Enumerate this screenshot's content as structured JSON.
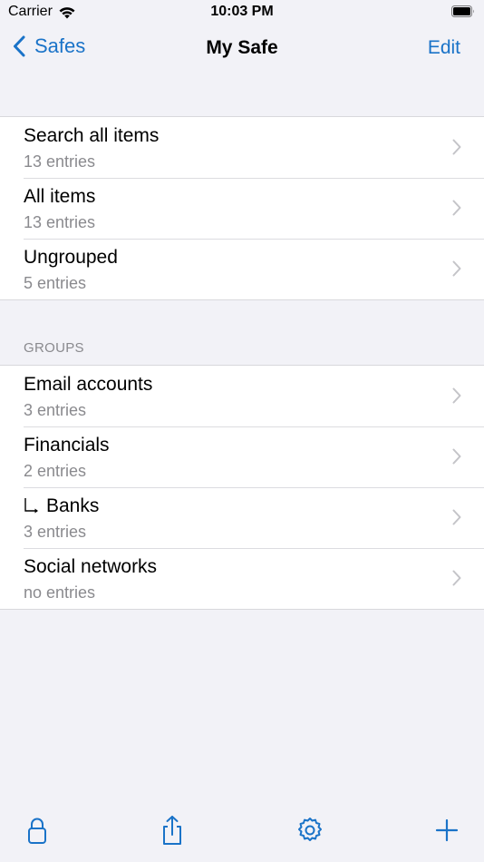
{
  "status_bar": {
    "carrier": "Carrier",
    "time": "10:03 PM"
  },
  "nav": {
    "back_label": "Safes",
    "title": "My Safe",
    "edit_label": "Edit"
  },
  "top_items": [
    {
      "title": "Search all items",
      "subtitle": "13 entries"
    },
    {
      "title": "All items",
      "subtitle": "13 entries"
    },
    {
      "title": "Ungrouped",
      "subtitle": "5 entries"
    }
  ],
  "groups_header": "GROUPS",
  "groups": [
    {
      "title": "Email accounts",
      "subtitle": "3 entries"
    },
    {
      "title": "Financials",
      "subtitle": "2 entries"
    },
    {
      "title": "Banks",
      "subtitle": "3 entries",
      "nested": true
    },
    {
      "title": "Social networks",
      "subtitle": "no entries"
    }
  ],
  "colors": {
    "accent": "#1a73c8",
    "background": "#f2f2f7",
    "secondary_text": "#8a8a8e"
  },
  "toolbar": {
    "icons": [
      "lock-icon",
      "share-icon",
      "gear-icon",
      "plus-icon"
    ]
  }
}
